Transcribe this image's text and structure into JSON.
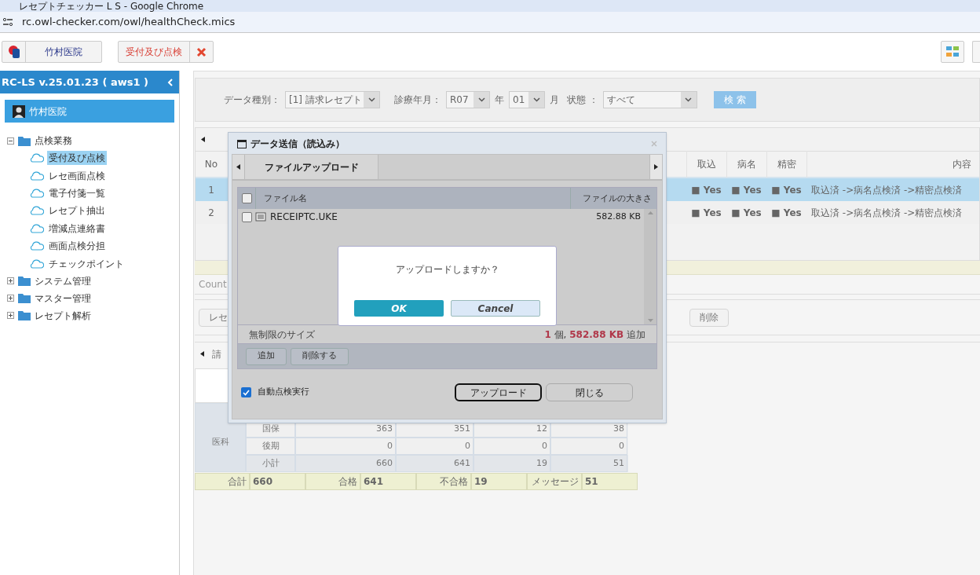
{
  "browser": {
    "title": "レセプトチェッカー L S - Google Chrome",
    "url": "rc.owl-checker.com/owl/healthCheck.mics"
  },
  "toolbar": {
    "clinic": "竹村医院",
    "tabs": [
      {
        "label": "受付及び点検",
        "selected": true
      }
    ]
  },
  "sidebar": {
    "version": "RC-LS v.25.01.23 ( aws1 )",
    "user": "竹村医院",
    "tree": [
      {
        "label": "点検業務",
        "expanded": true,
        "children": [
          {
            "label": "受付及び点検",
            "selected": true
          },
          {
            "label": "レセ画面点検",
            "selected": false
          },
          {
            "label": "電子付箋一覧",
            "selected": false
          },
          {
            "label": "レセプト抽出",
            "selected": false
          },
          {
            "label": "増減点連絡書",
            "selected": false
          },
          {
            "label": "画面点検分担",
            "selected": false
          },
          {
            "label": "チェックポイント",
            "selected": false
          }
        ]
      },
      {
        "label": "システム管理",
        "expanded": false
      },
      {
        "label": "マスター管理",
        "expanded": false
      },
      {
        "label": "レセプト解析",
        "expanded": false
      }
    ]
  },
  "filters": {
    "data_type_label": "データ種別：",
    "data_type": "[1] 請求レセプト",
    "period_label": "診療年月：",
    "era_year": "R07",
    "year_unit": "年",
    "month": "01",
    "month_unit": "月",
    "status_label": "状態 ：",
    "status": "すべて",
    "search": "検 索"
  },
  "results": {
    "columns": [
      "No",
      "取込",
      "病名",
      "精密",
      "内容"
    ],
    "rows": [
      {
        "no": "1",
        "selected": true,
        "flags": [
          "■ Yes",
          "■ Yes",
          "■ Yes"
        ],
        "content": "取込済 ->病名点検済 ->精密点検済"
      },
      {
        "no": "2",
        "selected": false,
        "flags": [
          "■ Yes",
          "■ Yes",
          "■ Yes"
        ],
        "content": "取込済 ->病名点検済 ->精密点検済"
      }
    ]
  },
  "count_label": "Count",
  "action_buttons": [
    "レセ",
    "削除"
  ],
  "lower_tab": "請",
  "summary": {
    "group": "医科",
    "rows": [
      {
        "label": "国保",
        "values": [
          "363",
          "351",
          "12",
          "38"
        ]
      },
      {
        "label": "後期",
        "values": [
          "0",
          "0",
          "0",
          "0"
        ]
      },
      {
        "label": "小計",
        "values": [
          "660",
          "641",
          "19",
          "51"
        ]
      }
    ],
    "totals": [
      {
        "label": "合計",
        "value": "660"
      },
      {
        "label": "合格",
        "value": "641"
      },
      {
        "label": "不合格",
        "value": "19"
      },
      {
        "label": "メッセージ",
        "value": "51"
      }
    ]
  },
  "upload_dialog": {
    "title": "データ送信（読込み）",
    "tabs": [
      {
        "label": "ファイルアップロード",
        "selected": true
      }
    ],
    "columns": [
      "ファイル名",
      "ファイルの大きさ"
    ],
    "select_all": false,
    "files": [
      {
        "name": "RECEIPTC.UKE",
        "size": "582.88 KB",
        "checked": false
      }
    ],
    "size_limit": "無制限のサイズ",
    "summary": "**1** 個, **582.88 KB** 追加",
    "list_buttons": [
      "追加",
      "削除する"
    ],
    "auto_check": {
      "label": "自動点検実行",
      "checked": true
    },
    "buttons": [
      "アップロード",
      "閉じる"
    ]
  },
  "confirm": {
    "message": "アップロードしますか？",
    "ok": "OK",
    "cancel": "Cancel"
  }
}
